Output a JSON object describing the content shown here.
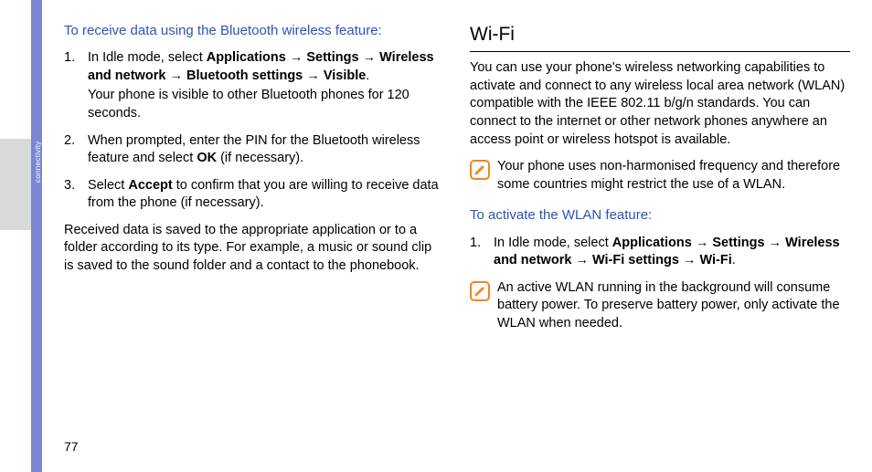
{
  "sidebar": {
    "tab_label": "connectivity"
  },
  "page_number": "77",
  "left": {
    "subhead": "To receive data using the Bluetooth wireless feature:",
    "steps": [
      {
        "num": "1.",
        "prefix": "In Idle mode, select ",
        "path": [
          "Applications",
          "Settings",
          "Wireless and network",
          "Bluetooth settings",
          "Visible"
        ],
        "suffix": ".",
        "note": "Your phone is visible to other Bluetooth phones for 120 seconds."
      },
      {
        "num": "2.",
        "text_a": "When prompted, enter the PIN for the Bluetooth wireless feature and select ",
        "bold_a": "OK",
        "text_b": " (if necessary)."
      },
      {
        "num": "3.",
        "text_a": "Select ",
        "bold_a": "Accept",
        "text_b": " to confirm that you are willing to receive data from the phone (if necessary)."
      }
    ],
    "para": "Received data is saved to the appropriate application or to a folder according to its type. For example, a music or sound clip is saved to the sound folder and a contact to the phonebook."
  },
  "right": {
    "head": "Wi-Fi",
    "intro": "You can use your phone's wireless networking capabilities to activate and connect to any wireless local area network (WLAN) compatible with the IEEE 802.11 b/g/n standards. You can connect to the internet or other network phones anywhere an access point or wireless hotspot is available.",
    "note1": "Your phone uses non-harmonised frequency and therefore some countries might restrict the use of a WLAN.",
    "subhead": "To activate the WLAN feature:",
    "step1": {
      "num": "1.",
      "prefix": "In Idle mode, select ",
      "path": [
        "Applications",
        "Settings",
        "Wireless and network",
        "Wi-Fi settings",
        "Wi-Fi"
      ],
      "suffix": "."
    },
    "note2": "An active WLAN running in the background will consume battery power. To preserve battery power, only activate the WLAN when needed."
  },
  "arrow": "→"
}
